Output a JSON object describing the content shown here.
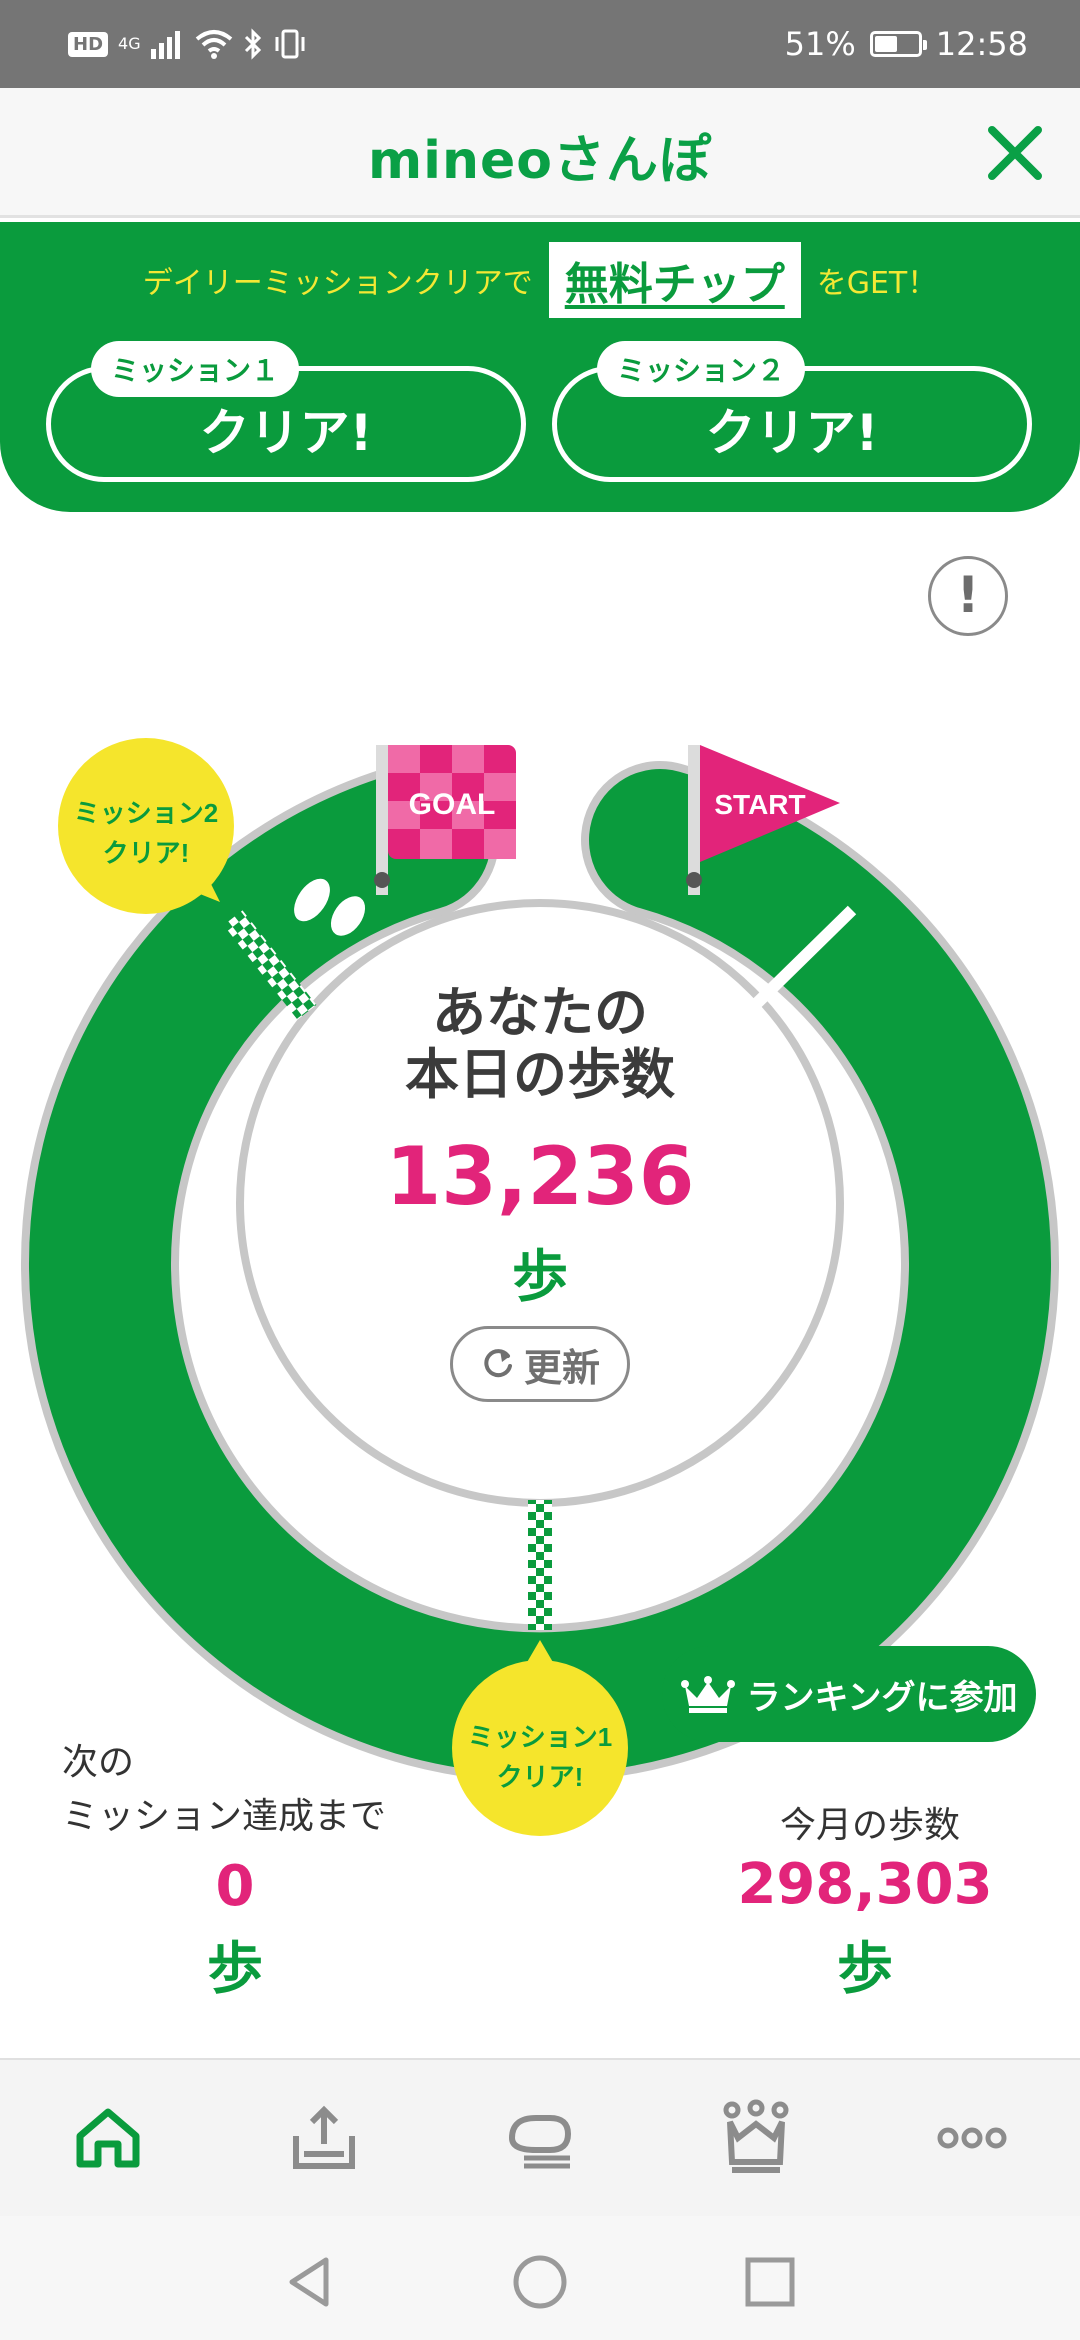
{
  "status_bar": {
    "left_hd": "HD",
    "left_signal": "4G",
    "battery_percent": "51%",
    "time": "12:58",
    "icons": [
      "hd-icon",
      "signal-icon",
      "wifi-icon",
      "bluetooth-icon",
      "vibrate-icon",
      "battery-icon"
    ]
  },
  "header": {
    "title": "mineoさんぽ",
    "close_icon": "close-icon"
  },
  "mission_banner": {
    "prefix": "デイリーミッションクリアで",
    "highlight": "無料チップ",
    "suffix": "をGET！",
    "missions": [
      {
        "tag": "ミッション１",
        "status": "クリア!"
      },
      {
        "tag": "ミッション２",
        "status": "クリア!"
      }
    ]
  },
  "info_button": "!",
  "course": {
    "goal_flag": "GOAL",
    "start_flag": "START",
    "mission1_bubble": [
      "ミッション1",
      "クリア!"
    ],
    "mission2_bubble": [
      "ミッション2",
      "クリア!"
    ],
    "colors": {
      "track": "#0a9b3d",
      "pink": "#e2247a",
      "yellow": "#f5e52c"
    }
  },
  "today": {
    "label_line1": "あなたの",
    "label_line2": "本日の歩数",
    "steps": "13,236",
    "unit": "歩",
    "refresh": "更新"
  },
  "ranking_button": "ランキングに参加",
  "next_mission": {
    "label_line1": "次の",
    "label_line2": "ミッション達成まで",
    "value": "0",
    "unit": "歩"
  },
  "month": {
    "label": "今月の歩数",
    "value": "298,303",
    "unit": "歩"
  },
  "bottom_nav": [
    "home-icon",
    "upload-icon",
    "chat-icon",
    "ranking-crown-icon",
    "more-icon"
  ],
  "system_nav": [
    "back-icon",
    "home-circle-icon",
    "recents-icon"
  ]
}
